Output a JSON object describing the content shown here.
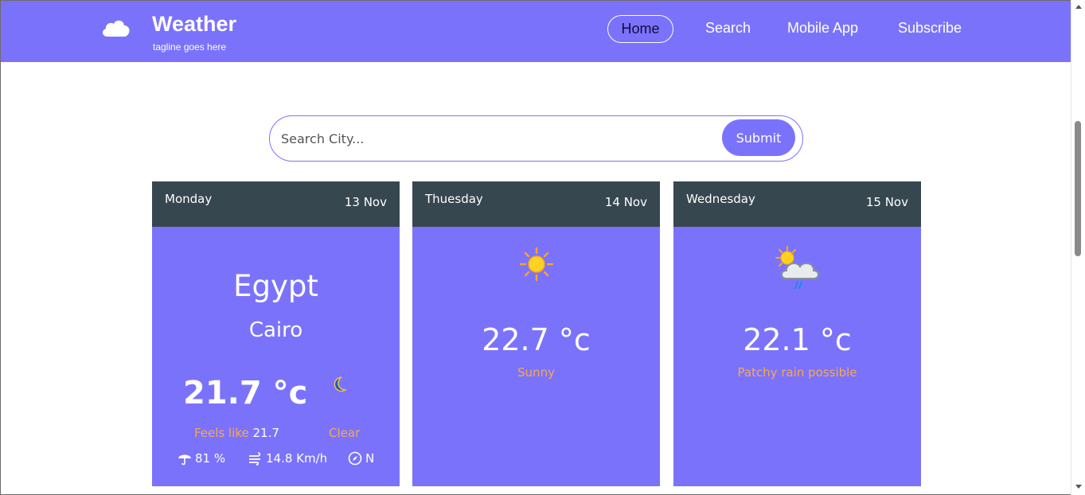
{
  "header": {
    "title": "Weather",
    "tagline": "tagline goes here",
    "logo_icon": "cloud-icon",
    "nav": [
      {
        "label": "Home",
        "active": true
      },
      {
        "label": "Search"
      },
      {
        "label": "Mobile App"
      },
      {
        "label": "Subscribe"
      }
    ]
  },
  "search": {
    "placeholder": "Search City...",
    "value": "",
    "submit_label": "Submit"
  },
  "colors": {
    "accent": "#7b72fc",
    "card_header": "#37474f",
    "condition_text": "#f5a953"
  },
  "cards": [
    {
      "day": "Monday",
      "date": "13 Nov",
      "country": "Egypt",
      "city": "Cairo",
      "temp": "21.7 °c",
      "icon": "moon-icon",
      "feels_label": "Feels like",
      "feels_value": "21.7",
      "condition": "Clear",
      "humidity": "81 %",
      "wind": "14.8 Km/h",
      "direction": "N"
    },
    {
      "day": "Thuesday",
      "date": "14 Nov",
      "icon": "sun-icon",
      "temp": "22.7 °c",
      "condition": "Sunny"
    },
    {
      "day": "Wednesday",
      "date": "15 Nov",
      "icon": "patchy-rain-icon",
      "temp": "22.1 °c",
      "condition": "Patchy rain possible"
    }
  ]
}
